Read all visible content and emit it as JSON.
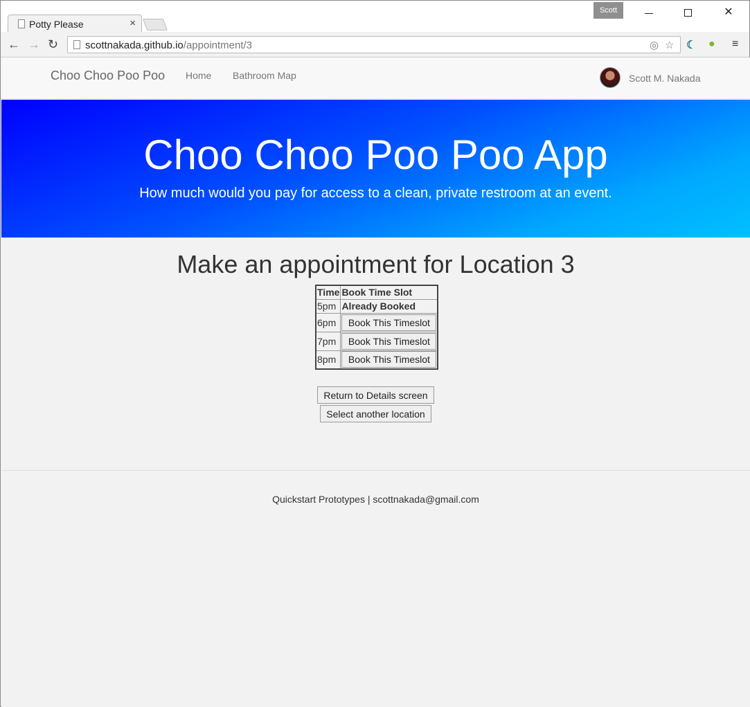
{
  "browser": {
    "tab_title": "Potty Please",
    "tab_close": "×",
    "user_badge": "Scott",
    "url_host": "scottnakada.github.io",
    "url_path": "/appointment/3",
    "window_close": "✕"
  },
  "nav": {
    "brand": "Choo Choo Poo Poo",
    "links": [
      "Home",
      "Bathroom Map"
    ],
    "user_name": "Scott M. Nakada"
  },
  "hero": {
    "title": "Choo Choo Poo Poo App",
    "subtitle": "How much would you pay for access to a clean, private restroom at an event."
  },
  "main": {
    "title": "Make an appointment for Location 3",
    "table": {
      "headers": [
        "Time",
        "Book Time Slot"
      ],
      "rows": [
        {
          "time": "5pm",
          "status": "Already Booked"
        },
        {
          "time": "6pm",
          "button": "Book This Timeslot"
        },
        {
          "time": "7pm",
          "button": "Book This Timeslot"
        },
        {
          "time": "8pm",
          "button": "Book This Timeslot"
        }
      ]
    },
    "return_button": "Return to Details screen",
    "select_button": "Select another location"
  },
  "footer": {
    "text": "Quickstart Prototypes | scottnakada@gmail.com"
  },
  "icons": {
    "back": "back-arrow-icon",
    "forward": "forward-arrow-icon",
    "reload": "reload-icon",
    "star": "star-icon",
    "menu": "hamburger-menu-icon"
  },
  "colors": {
    "hero_start": "#0000ff",
    "hero_end": "#00c0ff"
  }
}
